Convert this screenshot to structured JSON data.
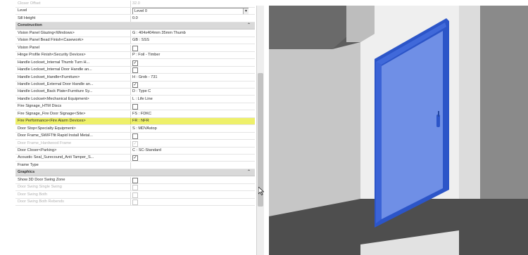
{
  "properties": {
    "rows": [
      {
        "type": "prop",
        "label": "Closer Offset",
        "value": "32.0",
        "dim": true
      },
      {
        "type": "prop",
        "label": "Level",
        "value": "Level 0",
        "combo": true
      },
      {
        "type": "prop",
        "label": "Sill Height",
        "value": "0.0"
      },
      {
        "type": "group",
        "label": "Construction",
        "toggle": "⌃"
      },
      {
        "type": "prop",
        "label": "Vision Panel Glazing<Windows>",
        "value": "G : 404x404mm 35mm Thumb"
      },
      {
        "type": "prop",
        "label": "Vision Panel Bead Finish<Casework>",
        "value": "GB : SSS"
      },
      {
        "type": "prop",
        "label": "Vision Panel",
        "check": ""
      },
      {
        "type": "prop",
        "label": "Hinge Profile Finish<Security Devices>",
        "value": "P : Foil - Timber"
      },
      {
        "type": "prop",
        "label": "Handle Lockset_Internal Thumb Turn H...",
        "check": "✓"
      },
      {
        "type": "prop",
        "label": "Handle Lockset_Internal Door Handle an...",
        "check": ""
      },
      {
        "type": "prop",
        "label": "Handle Lockset_Handle<Furniture>",
        "value": "H : Grob - 731"
      },
      {
        "type": "prop",
        "label": "Handle Lockset_External Door Handle an...",
        "check": "✓"
      },
      {
        "type": "prop",
        "label": "Handle Lockset_Back Plate<Furniture Sy...",
        "value": "D : Type C"
      },
      {
        "type": "prop",
        "label": "Handle Lockset<Mechanical Equipment>",
        "value": "L : Life Line"
      },
      {
        "type": "prop",
        "label": "Fire Signage_HTM Discs",
        "check": ""
      },
      {
        "type": "prop",
        "label": "Fire Signage_Fire Door Signage<Site>",
        "value": "FS : FDKC"
      },
      {
        "type": "prop",
        "label": "Fire Performance<Fire Alarm Devices>",
        "value": "FR : NFR",
        "highlight": true
      },
      {
        "type": "prop",
        "label": "Door Stop<Specialty Equipment>",
        "value": "S : MDVAstop"
      },
      {
        "type": "prop",
        "label": "Door Frame_SWIFTfit Rapid Install Metal...",
        "check": ""
      },
      {
        "type": "prop",
        "label": "Door Frame_Hardwood Frame",
        "check": "✓",
        "dim": true
      },
      {
        "type": "prop",
        "label": "Door Closer<Parking>",
        "value": "C : SC-Standard"
      },
      {
        "type": "prop",
        "label": "Acoustic Seal_Surecound_Anti Tamper_S...",
        "check": "✓"
      },
      {
        "type": "prop",
        "label": "Frame Type",
        "value": ""
      },
      {
        "type": "group",
        "label": "Graphics",
        "toggle": "⌃"
      },
      {
        "type": "prop",
        "label": "Show 3D Door Swing Zone",
        "check": ""
      },
      {
        "type": "prop",
        "label": "Door Swing Single Swing",
        "check": "",
        "dim": true
      },
      {
        "type": "prop",
        "label": "Door Swing Both",
        "check": "",
        "dim": true
      },
      {
        "type": "prop",
        "label": "Door Swing Both Rebends",
        "check": "",
        "dim": true
      }
    ]
  },
  "colors": {
    "highlight": "#eef06a",
    "door_fill": "#6f8fe6",
    "door_frame": "#2c55c8",
    "wall_light": "#efefef",
    "wall_mid": "#c8c8c8",
    "wall_dark": "#5d5d5d"
  },
  "icons": {
    "cursor": "mouse-pointer-icon",
    "door_handle": "door-handle-icon"
  }
}
